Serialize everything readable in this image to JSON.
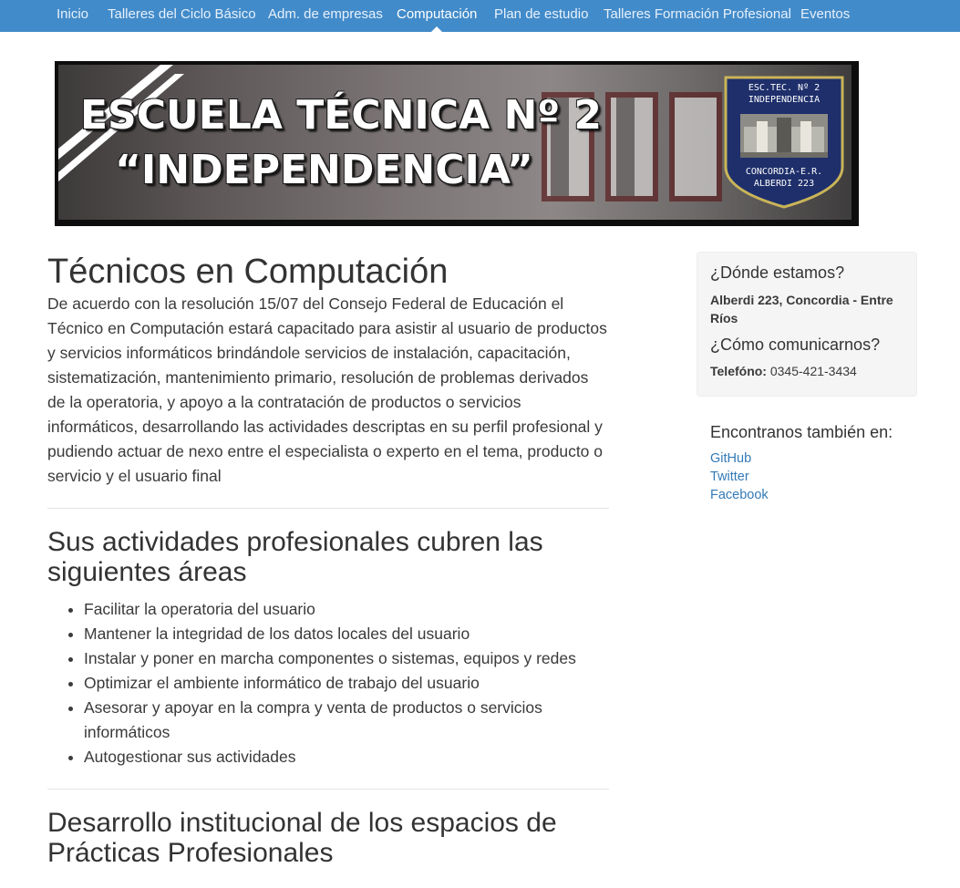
{
  "nav": {
    "items": [
      {
        "label": "Inicio",
        "active": false
      },
      {
        "label": "Talleres del Ciclo Básico",
        "active": false
      },
      {
        "label": "Adm. de empresas",
        "active": false
      },
      {
        "label": "Computación",
        "active": true
      },
      {
        "label": "Plan de estudio",
        "active": false
      },
      {
        "label": "Talleres Formación Profesional",
        "active": false
      },
      {
        "label": "Eventos",
        "active": false
      }
    ]
  },
  "banner": {
    "line1": "ESCUELA TÉCNICA Nº 2",
    "line2": "“INDEPENDENCIA”",
    "badge": {
      "top_line1": "ESC.TEC. Nº 2",
      "top_line2": "INDEPENDENCIA",
      "bottom_line1": "CONCORDIA-E.R.",
      "bottom_line2": "ALBERDI 223"
    }
  },
  "main": {
    "title": "Técnicos en Computación",
    "intro": "De acuerdo con la resolución 15/07 del Consejo Federal de Educación el Técnico en Computación estará capacitado para asistir al usuario de productos y servicios informáticos brindándole servicios de instalación, capacitación, sistematización, mantenimiento primario, resolución de problemas derivados de la operatoria, y apoyo a la contratación de productos o servicios informáticos, desarrollando las actividades descriptas en su perfil profesional y pudiendo actuar de nexo entre el especialista o experto en el tema, producto o servicio y el usuario final",
    "areas_title": "Sus actividades profesionales cubren las siguientes áreas",
    "areas": [
      "Facilitar la operatoria del usuario",
      "Mantener la integridad de los datos locales del usuario",
      "Instalar y poner en marcha componentes o sistemas, equipos y redes",
      "Optimizar el ambiente informático de trabajo del usuario",
      "Asesorar y apoyar en la compra y venta de productos o servicios informáticos",
      "Autogestionar sus actividades"
    ],
    "practicas_title": "Desarrollo institucional de los espacios de Prácticas Profesionales"
  },
  "sidebar": {
    "where_title": "¿Dónde estamos?",
    "address": "Alberdi 223, Concordia - Entre Ríos",
    "contact_title": "¿Cómo comunicarnos?",
    "phone_label": "Telefóno:",
    "phone": "0345-421-3434",
    "links_title": "Encontranos también en:",
    "links": [
      "GitHub",
      "Twitter",
      "Facebook"
    ]
  }
}
